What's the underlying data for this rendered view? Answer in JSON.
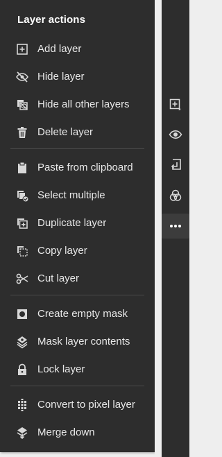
{
  "menu": {
    "title": "Layer actions",
    "groups": [
      [
        {
          "label": "Add layer",
          "icon": "add-layer-icon"
        },
        {
          "label": "Hide layer",
          "icon": "hide-eye-icon"
        },
        {
          "label": "Hide all other layers",
          "icon": "hide-others-icon"
        },
        {
          "label": "Delete layer",
          "icon": "trash-icon"
        }
      ],
      [
        {
          "label": "Paste from clipboard",
          "icon": "clipboard-icon"
        },
        {
          "label": "Select multiple",
          "icon": "select-multiple-icon"
        },
        {
          "label": "Duplicate layer",
          "icon": "duplicate-icon"
        },
        {
          "label": "Copy layer",
          "icon": "copy-icon"
        },
        {
          "label": "Cut layer",
          "icon": "scissors-icon"
        }
      ],
      [
        {
          "label": "Create empty mask",
          "icon": "mask-icon"
        },
        {
          "label": "Mask layer contents",
          "icon": "mask-contents-icon"
        },
        {
          "label": "Lock layer",
          "icon": "lock-icon"
        }
      ],
      [
        {
          "label": "Convert to pixel layer",
          "icon": "pixel-layer-icon"
        },
        {
          "label": "Merge down",
          "icon": "merge-down-icon"
        }
      ]
    ]
  },
  "rail": {
    "buttons": [
      {
        "icon": "add-layer-icon",
        "active": false
      },
      {
        "icon": "eye-icon",
        "active": false
      },
      {
        "icon": "import-icon",
        "active": false
      },
      {
        "icon": "blend-icon",
        "active": false
      },
      {
        "icon": "more-icon",
        "active": true
      }
    ]
  },
  "colors": {
    "panel": "#2d2d2d",
    "text": "#e8e8e8",
    "icon": "#d8d8d8",
    "divider": "#4a4a4a",
    "rail_active": "#3c3c3c",
    "background": "#eeeeee"
  }
}
